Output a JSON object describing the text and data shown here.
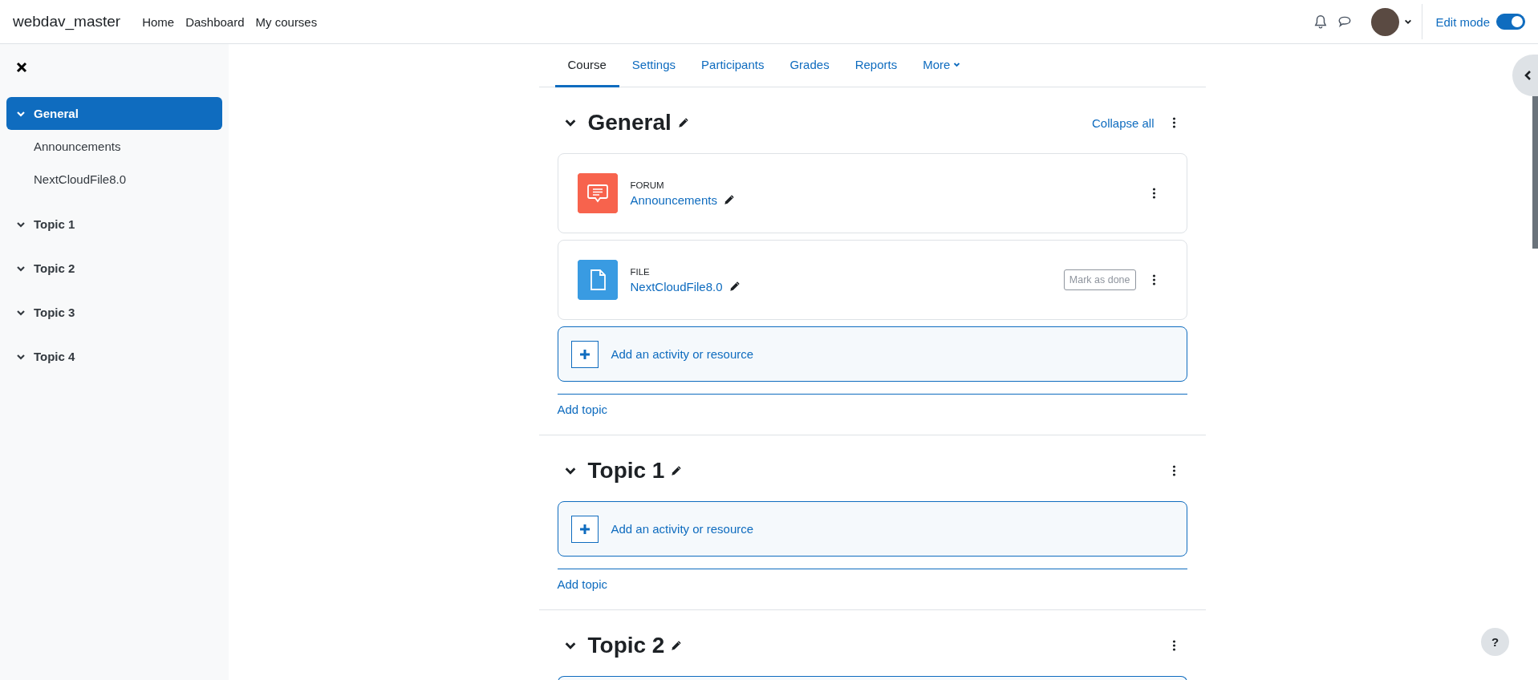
{
  "navbar": {
    "site_name": "webdav_master",
    "links": [
      "Home",
      "Dashboard",
      "My courses"
    ],
    "edit_mode": {
      "label": "Edit mode",
      "on": true
    }
  },
  "sidebar": {
    "items": [
      {
        "label": "General",
        "selected": true,
        "expanded": true,
        "children": [
          {
            "label": "Announcements"
          },
          {
            "label": "NextCloudFile8.0"
          }
        ]
      },
      {
        "label": "Topic 1",
        "selected": false,
        "expanded": true
      },
      {
        "label": "Topic 2",
        "selected": false,
        "expanded": true
      },
      {
        "label": "Topic 3",
        "selected": false,
        "expanded": true
      },
      {
        "label": "Topic 4",
        "selected": false,
        "expanded": true
      }
    ]
  },
  "tabs": [
    {
      "label": "Course",
      "selected": true
    },
    {
      "label": "Settings",
      "selected": false
    },
    {
      "label": "Participants",
      "selected": false
    },
    {
      "label": "Grades",
      "selected": false
    },
    {
      "label": "Reports",
      "selected": false
    },
    {
      "label": "More",
      "selected": false,
      "kind": "dropdown"
    }
  ],
  "sections": [
    {
      "title": "General",
      "collapse_all": "Collapse all",
      "activities": [
        {
          "kind": "forum",
          "type_label": "FORUM",
          "name": "Announcements"
        },
        {
          "kind": "file",
          "type_label": "FILE",
          "name": "NextCloudFile8.0",
          "mark_done": "Mark as done"
        }
      ],
      "add_activity": "Add an activity or resource",
      "add_topic": "Add topic"
    },
    {
      "title": "Topic 1",
      "add_activity": "Add an activity or resource",
      "add_topic": "Add topic"
    },
    {
      "title": "Topic 2"
    }
  ],
  "help_button": "?"
}
